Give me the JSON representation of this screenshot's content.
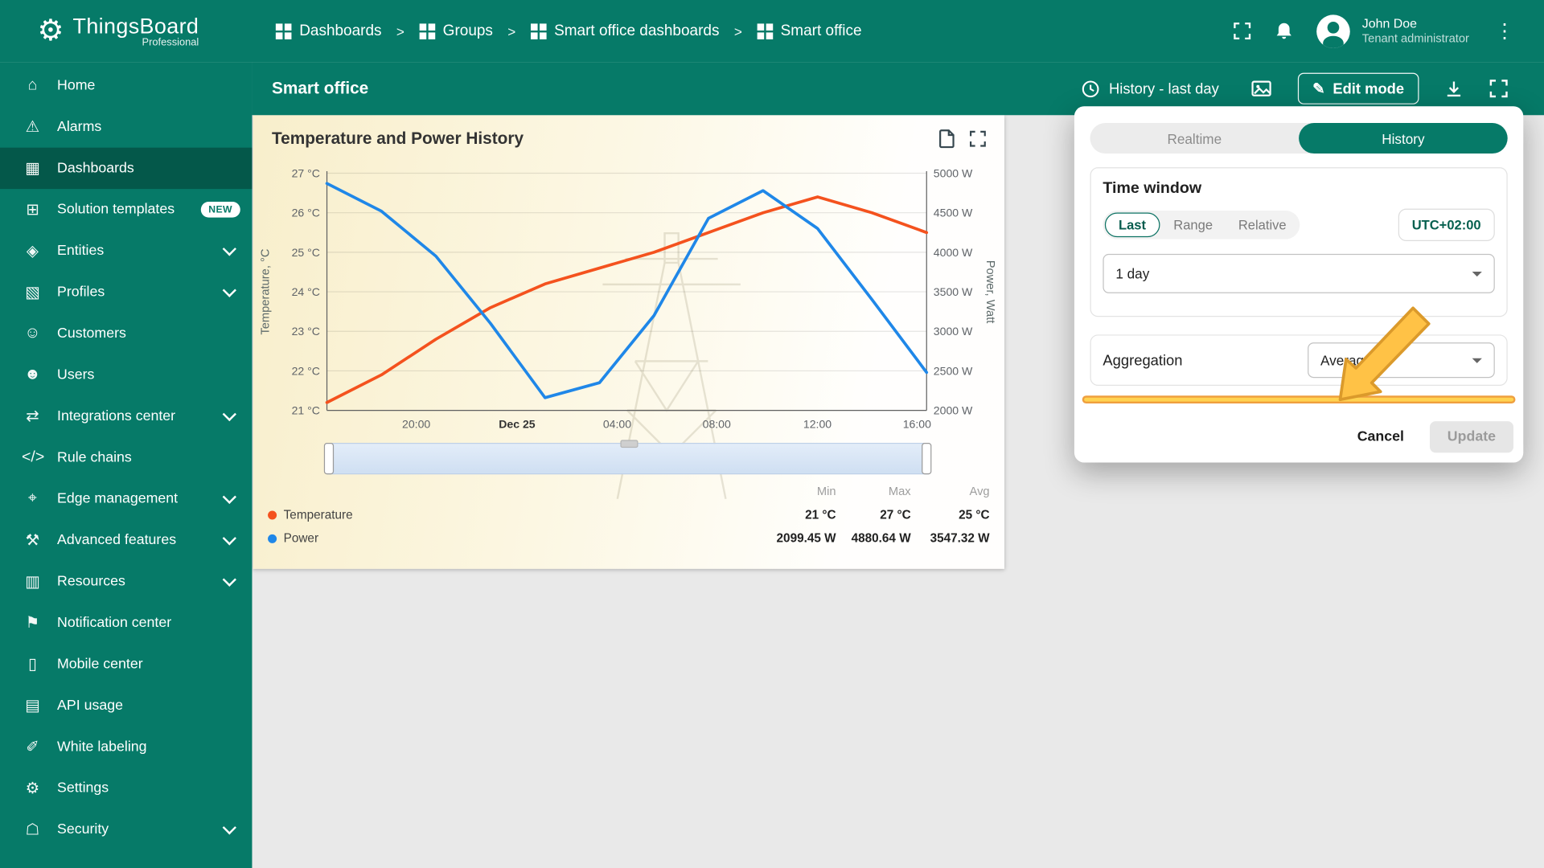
{
  "brand": {
    "name": "ThingsBoard",
    "edition": "Professional"
  },
  "header": {
    "separator": ">",
    "breadcrumbs": [
      {
        "label": "Dashboards"
      },
      {
        "label": "Groups"
      },
      {
        "label": "Smart office dashboards"
      },
      {
        "label": "Smart office"
      }
    ],
    "user": {
      "name": "John Doe",
      "role": "Tenant administrator"
    }
  },
  "icons": {
    "logo": "⚙",
    "pencil": "✎",
    "dots": "⋮"
  },
  "sidebar": {
    "items": [
      {
        "label": "Home",
        "icon": "home-icon",
        "glyph": "⌂"
      },
      {
        "label": "Alarms",
        "icon": "alarms-icon",
        "glyph": "⚠"
      },
      {
        "label": "Dashboards",
        "icon": "dashboards-icon",
        "glyph": "▦",
        "selected": true
      },
      {
        "label": "Solution templates",
        "icon": "solution-templates-icon",
        "glyph": "⊞",
        "badge": "NEW"
      },
      {
        "label": "Entities",
        "icon": "entities-icon",
        "glyph": "◈",
        "expandable": true
      },
      {
        "label": "Profiles",
        "icon": "profiles-icon",
        "glyph": "▧",
        "expandable": true
      },
      {
        "label": "Customers",
        "icon": "customers-icon",
        "glyph": "☺"
      },
      {
        "label": "Users",
        "icon": "users-icon",
        "glyph": "☻"
      },
      {
        "label": "Integrations center",
        "icon": "integrations-center-icon",
        "glyph": "⇄",
        "expandable": true
      },
      {
        "label": "Rule chains",
        "icon": "rule-chains-icon",
        "glyph": "</>"
      },
      {
        "label": "Edge management",
        "icon": "edge-management-icon",
        "glyph": "⌖",
        "expandable": true
      },
      {
        "label": "Advanced features",
        "icon": "advanced-features-icon",
        "glyph": "⚒",
        "expandable": true
      },
      {
        "label": "Resources",
        "icon": "resources-icon",
        "glyph": "▥",
        "expandable": true
      },
      {
        "label": "Notification center",
        "icon": "notification-center-icon",
        "glyph": "⚑"
      },
      {
        "label": "Mobile center",
        "icon": "mobile-center-icon",
        "glyph": "▯"
      },
      {
        "label": "API usage",
        "icon": "api-usage-icon",
        "glyph": "▤"
      },
      {
        "label": "White labeling",
        "icon": "white-labeling-icon",
        "glyph": "✐"
      },
      {
        "label": "Settings",
        "icon": "settings-icon",
        "glyph": "⚙"
      },
      {
        "label": "Security",
        "icon": "security-icon",
        "glyph": "☖",
        "expandable": true
      }
    ]
  },
  "toolbar": {
    "title": "Smart office",
    "history_button": "History - last day",
    "edit_mode": "Edit mode"
  },
  "widget": {
    "title": "Temperature and Power History"
  },
  "stats": {
    "headers": [
      "Min",
      "Max",
      "Avg"
    ],
    "rows": [
      {
        "label": "Temperature",
        "color": "#f4521e",
        "min": "21 °C",
        "max": "27 °C",
        "avg": "25 °C"
      },
      {
        "label": "Power",
        "color": "#1f87e8",
        "min": "2099.45 W",
        "max": "4880.64 W",
        "avg": "3547.32 W"
      }
    ]
  },
  "chart_data": {
    "type": "line",
    "title": "Temperature and Power History",
    "x_ticks": [
      {
        "label": "20:00",
        "pos": 0.149
      },
      {
        "label": "Dec 25",
        "pos": 0.317,
        "bold": true
      },
      {
        "label": "04:00",
        "pos": 0.484
      },
      {
        "label": "08:00",
        "pos": 0.65
      },
      {
        "label": "12:00",
        "pos": 0.818
      },
      {
        "label": "16:00",
        "pos": 0.984
      }
    ],
    "left_axis": {
      "label": "Temperature, °C",
      "min": 21,
      "max": 27,
      "ticks": [
        "27 °C",
        "26 °C",
        "25 °C",
        "24 °C",
        "23 °C",
        "22 °C",
        "21 °C"
      ]
    },
    "right_axis": {
      "label": "Power, Watt",
      "min": 2000,
      "max": 5000,
      "ticks": [
        "5000 W",
        "4500 W",
        "4000 W",
        "3500 W",
        "3000 W",
        "2500 W",
        "2000 W"
      ]
    },
    "series": [
      {
        "name": "Temperature",
        "color": "#f4521e",
        "axis": "left",
        "values": [
          21.2,
          21.9,
          22.8,
          23.6,
          24.2,
          24.6,
          25.0,
          25.5,
          26.0,
          26.4,
          26.0,
          25.5
        ]
      },
      {
        "name": "Power",
        "color": "#1f87e8",
        "axis": "right",
        "values": [
          4870,
          4520,
          3950,
          3100,
          2160,
          2350,
          3200,
          4430,
          4780,
          4300,
          3400,
          2480
        ]
      }
    ],
    "summary": {
      "Temperature": {
        "min": "21 °C",
        "max": "27 °C",
        "avg": "25 °C"
      },
      "Power": {
        "min": "2099.45 W",
        "max": "4880.64 W",
        "avg": "3547.32 W"
      }
    }
  },
  "popup": {
    "tabs": [
      {
        "label": "Realtime"
      },
      {
        "label": "History",
        "selected": true
      }
    ],
    "time_window": {
      "title": "Time window",
      "modes": [
        {
          "label": "Last",
          "selected": true
        },
        {
          "label": "Range"
        },
        {
          "label": "Relative"
        }
      ],
      "timezone": "UTC+02:00",
      "interval": "1 day"
    },
    "aggregation": {
      "label": "Aggregation",
      "value": "Average"
    },
    "cancel": "Cancel",
    "update": "Update"
  }
}
